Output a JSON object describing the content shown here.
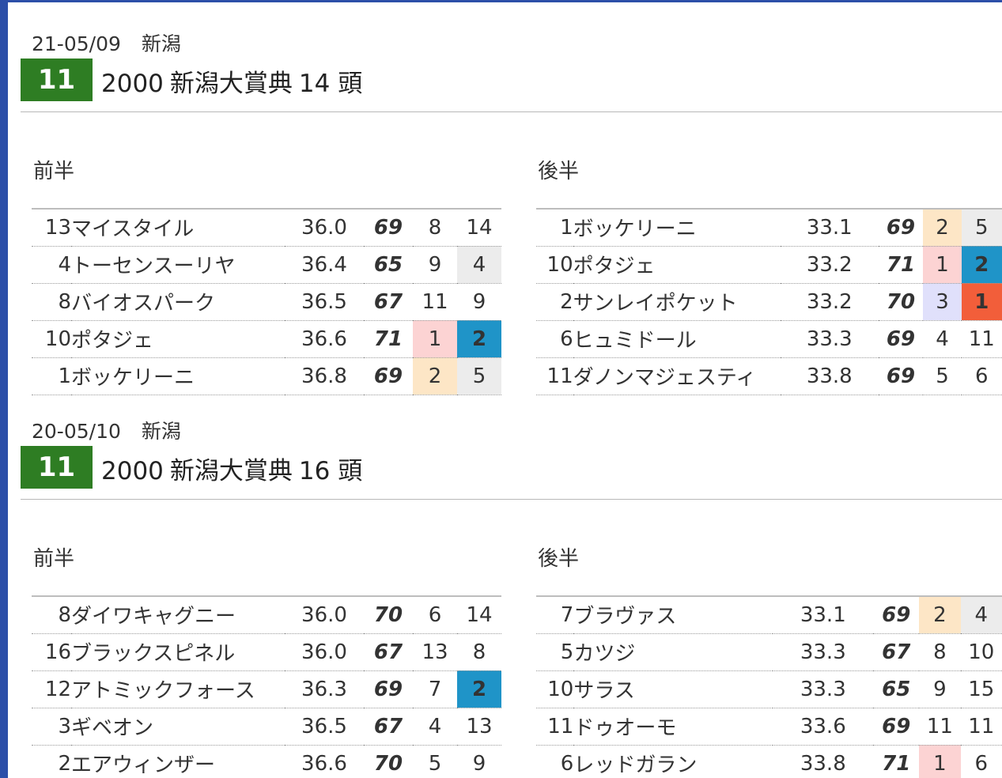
{
  "races": [
    {
      "date": "21-05/09",
      "venue": "新潟",
      "race_no": "11",
      "distance": "2000",
      "name": "新潟大賞典",
      "heads": "14 頭",
      "first_half": {
        "label": "前半",
        "rows": [
          {
            "no": "13",
            "name": "マイスタイル",
            "time": "36.0",
            "index": "69",
            "index_color": "green",
            "r1": "8",
            "r1_tone": "",
            "r2": "14",
            "r2_tone": ""
          },
          {
            "no": "4",
            "name": "トーセンスーリヤ",
            "time": "36.4",
            "index": "65",
            "index_color": "black",
            "r1": "9",
            "r1_tone": "",
            "r2": "4",
            "r2_tone": "gray"
          },
          {
            "no": "8",
            "name": "バイオスパーク",
            "time": "36.5",
            "index": "67",
            "index_color": "black",
            "r1": "11",
            "r1_tone": "",
            "r2": "9",
            "r2_tone": ""
          },
          {
            "no": "10",
            "name": "ポタジェ",
            "time": "36.6",
            "index": "71",
            "index_color": "red",
            "r1": "1",
            "r1_tone": "pink",
            "r2": "2",
            "r2_tone": "blue"
          },
          {
            "no": "1",
            "name": "ボッケリーニ",
            "time": "36.8",
            "index": "69",
            "index_color": "blue",
            "r1": "2",
            "r1_tone": "peach",
            "r2": "5",
            "r2_tone": "gray"
          }
        ]
      },
      "second_half": {
        "label": "後半",
        "rows": [
          {
            "no": "1",
            "name": "ボッケリーニ",
            "time": "33.1",
            "index": "69",
            "index_color": "blue",
            "r1": "2",
            "r1_tone": "peach",
            "r2": "5",
            "r2_tone": "gray"
          },
          {
            "no": "10",
            "name": "ポタジェ",
            "time": "33.2",
            "index": "71",
            "index_color": "red",
            "r1": "1",
            "r1_tone": "pink",
            "r2": "2",
            "r2_tone": "blue"
          },
          {
            "no": "2",
            "name": "サンレイポケット",
            "time": "33.2",
            "index": "70",
            "index_color": "blue",
            "r1": "3",
            "r1_tone": "lav",
            "r2": "1",
            "r2_tone": "orange"
          },
          {
            "no": "6",
            "name": "ヒュミドール",
            "time": "33.3",
            "index": "69",
            "index_color": "green",
            "r1": "4",
            "r1_tone": "",
            "r2": "11",
            "r2_tone": ""
          },
          {
            "no": "11",
            "name": "ダノンマジェスティ",
            "time": "33.8",
            "index": "69",
            "index_color": "red",
            "r1": "5",
            "r1_tone": "",
            "r2": "6",
            "r2_tone": ""
          }
        ]
      }
    },
    {
      "date": "20-05/10",
      "venue": "新潟",
      "race_no": "11",
      "distance": "2000",
      "name": "新潟大賞典",
      "heads": "16 頭",
      "first_half": {
        "label": "前半",
        "rows": [
          {
            "no": "8",
            "name": "ダイワキャグニー",
            "time": "36.0",
            "index": "70",
            "index_color": "blue",
            "r1": "6",
            "r1_tone": "",
            "r2": "14",
            "r2_tone": ""
          },
          {
            "no": "16",
            "name": "ブラックスピネル",
            "time": "36.0",
            "index": "67",
            "index_color": "black",
            "r1": "13",
            "r1_tone": "",
            "r2": "8",
            "r2_tone": ""
          },
          {
            "no": "12",
            "name": "アトミックフォース",
            "time": "36.3",
            "index": "69",
            "index_color": "black",
            "r1": "7",
            "r1_tone": "",
            "r2": "2",
            "r2_tone": "blue"
          },
          {
            "no": "3",
            "name": "ギベオン",
            "time": "36.5",
            "index": "67",
            "index_color": "black",
            "r1": "4",
            "r1_tone": "",
            "r2": "13",
            "r2_tone": ""
          },
          {
            "no": "2",
            "name": "エアウィンザー",
            "time": "36.6",
            "index": "70",
            "index_color": "blue",
            "r1": "5",
            "r1_tone": "",
            "r2": "9",
            "r2_tone": ""
          }
        ]
      },
      "second_half": {
        "label": "後半",
        "rows": [
          {
            "no": "7",
            "name": "ブラヴァス",
            "time": "33.1",
            "index": "69",
            "index_color": "green",
            "r1": "2",
            "r1_tone": "peach",
            "r2": "4",
            "r2_tone": "gray"
          },
          {
            "no": "5",
            "name": "カツジ",
            "time": "33.3",
            "index": "67",
            "index_color": "black",
            "r1": "8",
            "r1_tone": "",
            "r2": "10",
            "r2_tone": ""
          },
          {
            "no": "10",
            "name": "サラス",
            "time": "33.3",
            "index": "65",
            "index_color": "black",
            "r1": "9",
            "r1_tone": "",
            "r2": "15",
            "r2_tone": ""
          },
          {
            "no": "11",
            "name": "ドゥオーモ",
            "time": "33.6",
            "index": "69",
            "index_color": "red",
            "r1": "11",
            "r1_tone": "",
            "r2": "11",
            "r2_tone": ""
          },
          {
            "no": "6",
            "name": "レッドガラン",
            "time": "33.8",
            "index": "71",
            "index_color": "red",
            "r1": "1",
            "r1_tone": "pink",
            "r2": "6",
            "r2_tone": ""
          }
        ]
      }
    }
  ]
}
